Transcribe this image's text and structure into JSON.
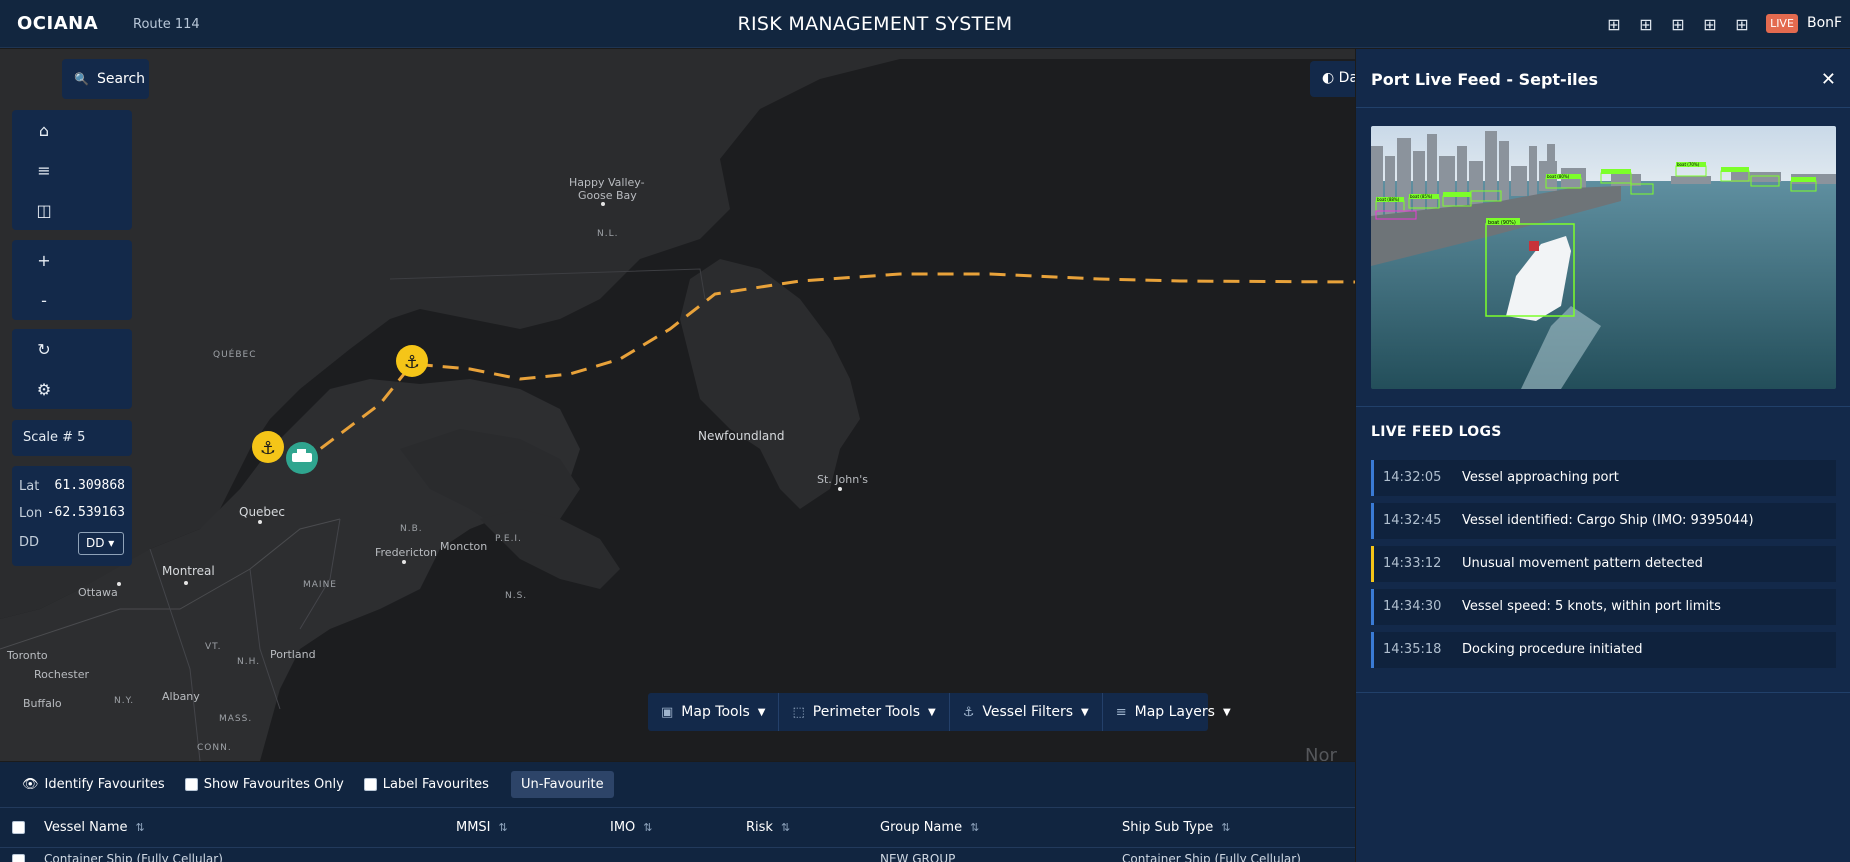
{
  "header": {
    "brand": "OCIANA",
    "route": "Route 114",
    "title": "RISK MANAGEMENT SYSTEM",
    "layout_icons": [
      "grid-icon",
      "grid-icon",
      "grid-icon",
      "grid-icon",
      "grid-icon"
    ],
    "live_badge": "LIVE",
    "user": "BonF"
  },
  "map": {
    "search_label": "Search",
    "dark_toggle_label": "Da",
    "toolbar_icons": [
      "home-icon",
      "list-icon",
      "map-icon",
      "zoom-in-icon",
      "zoom-out-icon",
      "refresh-icon",
      "settings-icon"
    ],
    "scale_label": "Scale # 5",
    "lat_label": "Lat",
    "lat_value": "61.309868",
    "lon_label": "Lon",
    "lon_value": "-62.539163",
    "format_label": "DD",
    "format_value": "DD ▾",
    "labels": {
      "happy_valley_1": "Happy Valley-",
      "happy_valley_2": "Goose Bay",
      "nl": "N.L.",
      "quebec_prov": "QUÉBEC",
      "quebec_city": "Quebec",
      "newfoundland": "Newfoundland",
      "st_johns": "St. John's",
      "nb": "N.B.",
      "pei": "P.E.I.",
      "fredericton": "Fredericton",
      "moncton": "Moncton",
      "ns": "N.S.",
      "maine": "MAINE",
      "montreal": "Montreal",
      "ottawa": "Ottawa",
      "toronto": "Toronto",
      "rochester": "Rochester",
      "buffalo": "Buffalo",
      "vt": "VT.",
      "nh": "N.H.",
      "portland": "Portland",
      "ny": "N.Y.",
      "albany": "Albany",
      "mass": "MASS.",
      "conn": "CONN.",
      "ocean_partial": "Nor"
    },
    "tools": [
      {
        "icon": "world-map-icon",
        "label": "Map Tools"
      },
      {
        "icon": "perimeter-icon",
        "label": "Perimeter Tools"
      },
      {
        "icon": "anchor-icon",
        "label": "Vessel Filters"
      },
      {
        "icon": "layers-icon",
        "label": "Map Layers"
      }
    ]
  },
  "favourites_bar": {
    "identify": "Identify Favourites",
    "show_only": "Show Favourites Only",
    "label": "Label Favourites",
    "unfavourite": "Un-Favourite"
  },
  "table": {
    "columns": [
      "Vessel Name",
      "MMSI",
      "IMO",
      "Risk",
      "Group Name",
      "Ship Sub Type"
    ],
    "rows": [
      [
        "Container Ship (Fully Cellular)",
        "",
        "",
        "",
        "NEW GROUP",
        "Container Ship (Fully Cellular)"
      ]
    ]
  },
  "right_panel": {
    "title": "Port Live Feed - Sept-iles",
    "logs_title": "LIVE FEED LOGS",
    "logs": [
      {
        "time": "14:32:05",
        "message": "Vessel approaching port",
        "level": "info"
      },
      {
        "time": "14:32:45",
        "message": "Vessel identified: Cargo Ship (IMO: 9395044)",
        "level": "info"
      },
      {
        "time": "14:33:12",
        "message": "Unusual movement pattern detected",
        "level": "warning"
      },
      {
        "time": "14:34:30",
        "message": "Vessel speed: 5 knots, within port limits",
        "level": "info"
      },
      {
        "time": "14:35:18",
        "message": "Docking procedure initiated",
        "level": "info"
      }
    ],
    "detection_labels": [
      "boat (90%)",
      "boat (88%)",
      "boat (85%)",
      "boat (80%)",
      "boat (70%)"
    ]
  },
  "colors": {
    "header_bg": "#12263f",
    "panel_bg": "#13294a",
    "route_line": "#e8a23a",
    "anchor_marker": "#f5c518",
    "ship_marker": "#2fa58f",
    "live_badge": "#e36a4f",
    "log_info_border": "#3a7bd5",
    "log_warning_border": "#f5c518",
    "detection_box": "#7cff2a"
  }
}
